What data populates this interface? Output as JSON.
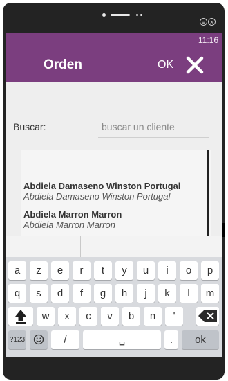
{
  "status": {
    "time": "11:16"
  },
  "header": {
    "title": "Orden",
    "ok_label": "OK"
  },
  "search": {
    "label": "Buscar:",
    "placeholder": "buscar un cliente"
  },
  "clients": [
    {
      "name": "Abdiela Damaseno Winston Portugal",
      "subtitle": "Abdiela Damaseno Winston Portugal"
    },
    {
      "name": "Abdiela Marron Marron",
      "subtitle": "Abdiela Marron Marron"
    }
  ],
  "keyboard": {
    "row1": [
      "a",
      "z",
      "e",
      "r",
      "t",
      "y",
      "u",
      "i",
      "o",
      "p"
    ],
    "row2": [
      "q",
      "s",
      "d",
      "f",
      "g",
      "h",
      "j",
      "k",
      "l",
      "m"
    ],
    "row3": [
      "w",
      "x",
      "c",
      "v",
      "b",
      "n",
      "'"
    ],
    "symbols_label": "?123",
    "slash_label": "/",
    "space_label": "␣",
    "period_label": ".",
    "ok_label": "ok"
  },
  "colors": {
    "appbar": "#7b3e7f",
    "keyboard_bg": "#d8dade"
  }
}
